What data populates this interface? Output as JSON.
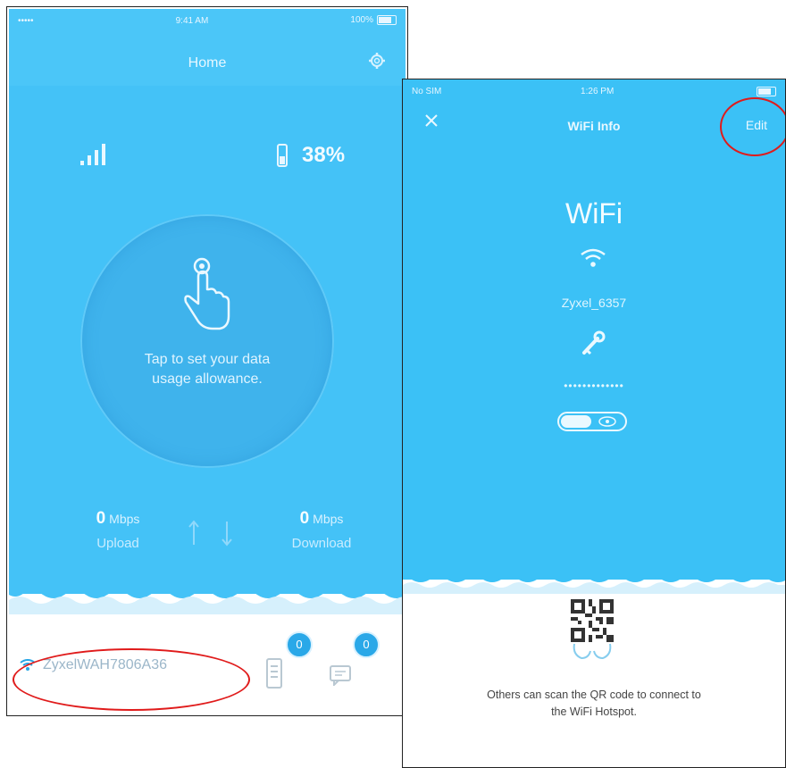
{
  "home": {
    "status_bar": {
      "carrier": "••••• ",
      "time": "9:41 AM",
      "battery": "100%"
    },
    "title": "Home",
    "battery_percent": "38%",
    "usage_prompt": "Tap to set your data\nusage allowance.",
    "upload": {
      "value": "0",
      "unit": "Mbps",
      "label": "Upload"
    },
    "download": {
      "value": "0",
      "unit": "Mbps",
      "label": "Download"
    },
    "ssid": "ZyxelWAH7806A36",
    "devices_count": "0",
    "messages_count": "0",
    "colors": {
      "primary": "#44c2f7",
      "highlight_ring": "#e01b1b"
    }
  },
  "wifi_info": {
    "status_bar": {
      "carrier": "No SIM",
      "time": "1:26 PM"
    },
    "title": "WiFi Info",
    "edit_label": "Edit",
    "heading": "WiFi",
    "ssid": "Zyxel_6357",
    "password_masked": "•••••••••••••",
    "qr_caption": "Others can scan the QR code to connect to\nthe WiFi Hotspot.",
    "colors": {
      "primary": "#3bc1f6"
    }
  }
}
